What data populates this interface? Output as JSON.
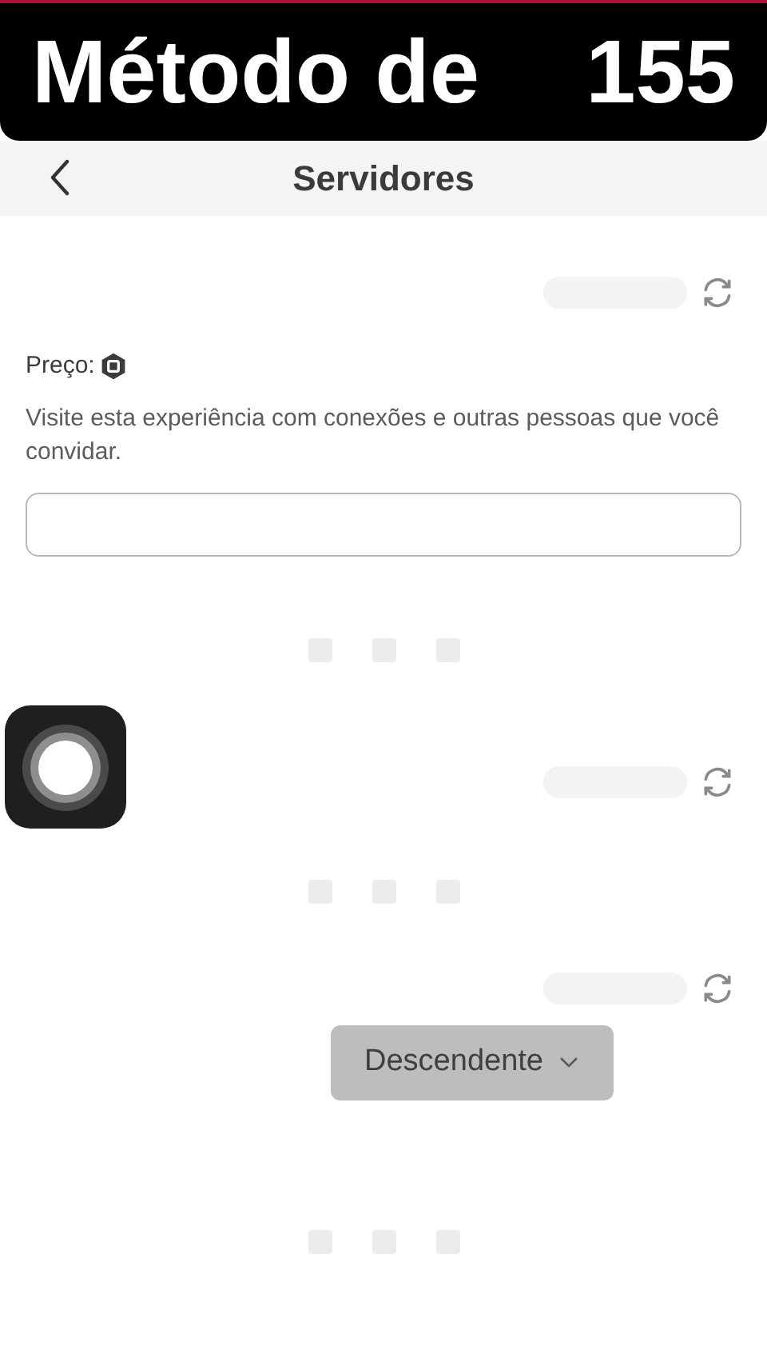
{
  "caption": {
    "parts": [
      "Método de",
      "155"
    ]
  },
  "header": {
    "title": "Servidores"
  },
  "price": {
    "label": "Preço:"
  },
  "description": "Visite esta experiência com conexões e outras pessoas que você convidar.",
  "sort": {
    "label": "Descendente"
  }
}
